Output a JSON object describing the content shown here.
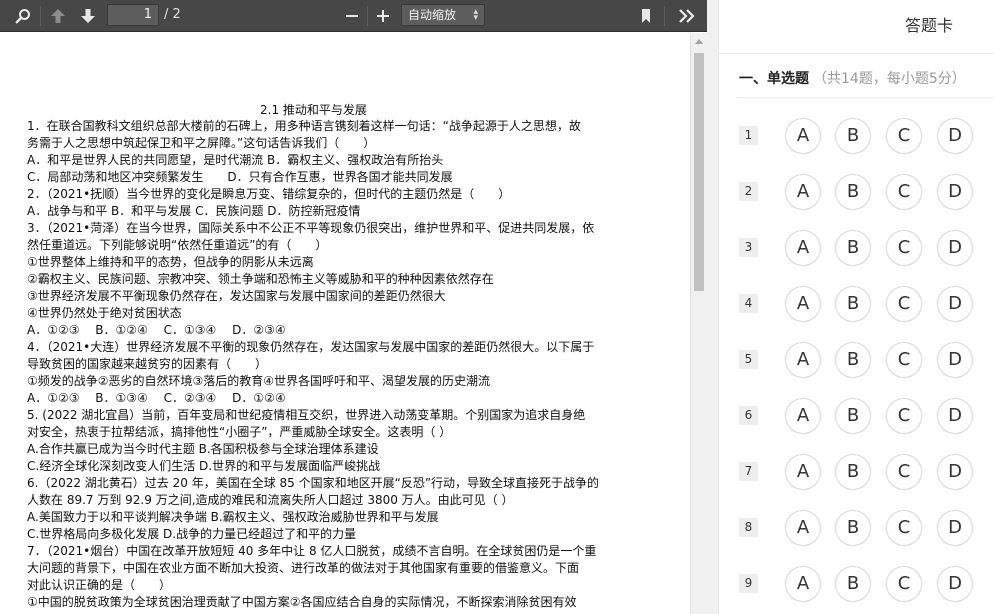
{
  "toolbar": {
    "page_current": "1",
    "page_total": "/ 2",
    "zoom_value": "自动缩放"
  },
  "document": {
    "title": "2.1 推动和平与发展",
    "lines": [
      "1．在联合国教科文组织总部大楼前的石碑上，用多种语言镌刻着这样一句话：“战争起源于人之思想，故",
      "务需于人之思想中筑起保卫和平之屏障。”这句话告诉我们（　　）",
      "A．和平是世界人民的共同愿望，是时代潮流 B．霸权主义、强权政治有所抬头",
      "C．局部动荡和地区冲突频繁发生　　D．只有合作互惠，世界各国才能共同发展",
      "2．（2021•抚顺）当今世界的变化是瞬息万变、错综复杂的，但时代的主题仍然是（　　）",
      "A．战争与和平 B．和平与发展 C．民族问题 D．防控新冠疫情",
      "3．（2021•菏泽）在当今世界，国际关系中不公正不平等现象仍很突出，维护世界和平、促进共同发展，依",
      "然任重道远。下列能够说明“依然任重道远”的有（　　）",
      "①世界整体上维持和平的态势，但战争的阴影从未远离",
      "②霸权主义、民族问题、宗教冲突、领土争端和恐怖主义等威胁和平的种种因素依然存在",
      "③世界经济发展不平衡现象仍然存在，发达国家与发展中国家间的差距仍然很大",
      "④世界仍然处于绝对贫困状态",
      "A．①②③　 B．①②④　 C．①③④　 D．②③④",
      "4．（2021•大连）世界经济发展不平衡的现象仍然存在，发达国家与发展中国家的差距仍然很大。以下属于",
      "导致贫困的国家越来越贫穷的因素有（　　）",
      "①频发的战争②恶劣的自然环境③落后的教育④世界各国呼吁和平、渴望发展的历史潮流",
      "A．①②③　 B．①③④　 C．②③④　 D．①②④",
      "5. (2022 湖北宜昌）当前，百年变局和世纪疫情相互交织，世界进入动荡变革期。个别国家为追求自身绝",
      "对安全，热衷于拉帮结派，搞排他性“小圈子”，严重威胁全球安全。这表明（ ）",
      "A.合作共赢已成为当今时代主题 B.各国积极参与全球治理体系建设",
      "C.经济全球化深刻改变人们生活 D.世界的和平与发展面临严峻挑战",
      "6.（2022 湖北黄石）过去 20 年，美国在全球 85 个国家和地区开展“反恐”行动，导致全球直接死于战争的",
      "人数在 89.7 万到 92.9 万之间,造成的难民和流离失所人口超过 3800 万人。由此可见（ ）",
      "A.美国致力于以和平谈判解决争端 B.霸权主义、强权政治威胁世界和平与发展",
      "C.世界格局向多极化发展 D.战争的力量已经超过了和平的力量",
      "7．（2021•烟台）中国在改革开放短短 40 多年中让 8 亿人口脱贫，成绩不言自明。在全球贫困仍是一个重",
      "大问题的背景下，中国在农业方面不断加大投资、进行改革的做法对于其他国家有重要的借鉴意义。下面",
      "对此认识正确的是（　　）",
      "①中国的脱贫政策为全球贫困治理贡献了中国方案②各国应结合自身的实际情况，不断探索消除贫困有效"
    ]
  },
  "answer_card": {
    "title": "答题卡",
    "section_name": "一、单选题",
    "section_meta": "（共14题，每小题5分）",
    "questions": [
      {
        "num": "1",
        "options": [
          "A",
          "B",
          "C",
          "D"
        ]
      },
      {
        "num": "2",
        "options": [
          "A",
          "B",
          "C",
          "D"
        ]
      },
      {
        "num": "3",
        "options": [
          "A",
          "B",
          "C",
          "D"
        ]
      },
      {
        "num": "4",
        "options": [
          "A",
          "B",
          "C",
          "D"
        ]
      },
      {
        "num": "5",
        "options": [
          "A",
          "B",
          "C",
          "D"
        ]
      },
      {
        "num": "6",
        "options": [
          "A",
          "B",
          "C",
          "D"
        ]
      },
      {
        "num": "7",
        "options": [
          "A",
          "B",
          "C",
          "D"
        ]
      },
      {
        "num": "8",
        "options": [
          "A",
          "B",
          "C",
          "D"
        ]
      },
      {
        "num": "9",
        "options": [
          "A",
          "B",
          "C",
          "D"
        ]
      }
    ]
  },
  "colors": {
    "toolbar_bg": "#474747",
    "option_border": "#d6d6d6",
    "number_badge_bg": "#eeeeee",
    "meta_text": "#999999"
  }
}
